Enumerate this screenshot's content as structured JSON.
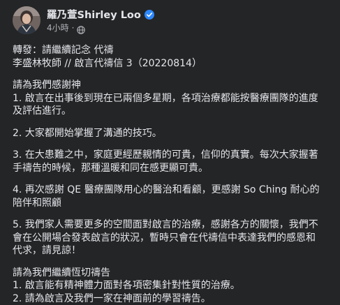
{
  "post": {
    "author_name": "羅乃萱Shirley Loo",
    "timestamp": "4小時",
    "dot": "·",
    "icons": {
      "verified": "verified-badge-icon",
      "audience": "globe-icon"
    },
    "colors": {
      "background": "#242526",
      "text": "#e4e6eb",
      "secondary_text": "#b0b3b8",
      "verified_blue": "#2d88ff"
    },
    "lines": {
      "l1": "轉發：請繼續記念 代禱",
      "l2": "李盛林牧師 // 啟言代禱信 3（20220814）",
      "l3": "請為我們感謝神",
      "l4": "1. 啟言在出事後到現在已兩個多星期，各項治療都能按醫療團隊的進度",
      "l5": "及評估進行。",
      "l6": "2. 大家都開始掌握了溝通的技巧。",
      "l7": "3. 在大患難之中，家庭更經歷親情的可貴，信仰的真實。每次大家握著",
      "l8": "手禱告的時候，那種溫暖和同在感更顯可貴。",
      "l9": "4. 再次感謝 QE 醫療團隊用心的醫治和看顧，更感謝 So Ching 耐心的",
      "l10": "陪伴和照顧",
      "l11": "5. 我們家人需要更多的空間面對啟言的治療，感謝各方的關懷，我們不",
      "l12": "會在公開場合發表啟言的狀況，暫時只會在代禱信中表達我們的感恩和",
      "l13": "代求，請見諒！",
      "l14": "請為我們繼續恆切禱告",
      "l15": "1. 啟言能有精神體力面對各項密集針對性質的治療。",
      "l16": "2. 請為啟言及我們一家在神面前的學習禱告。"
    }
  }
}
